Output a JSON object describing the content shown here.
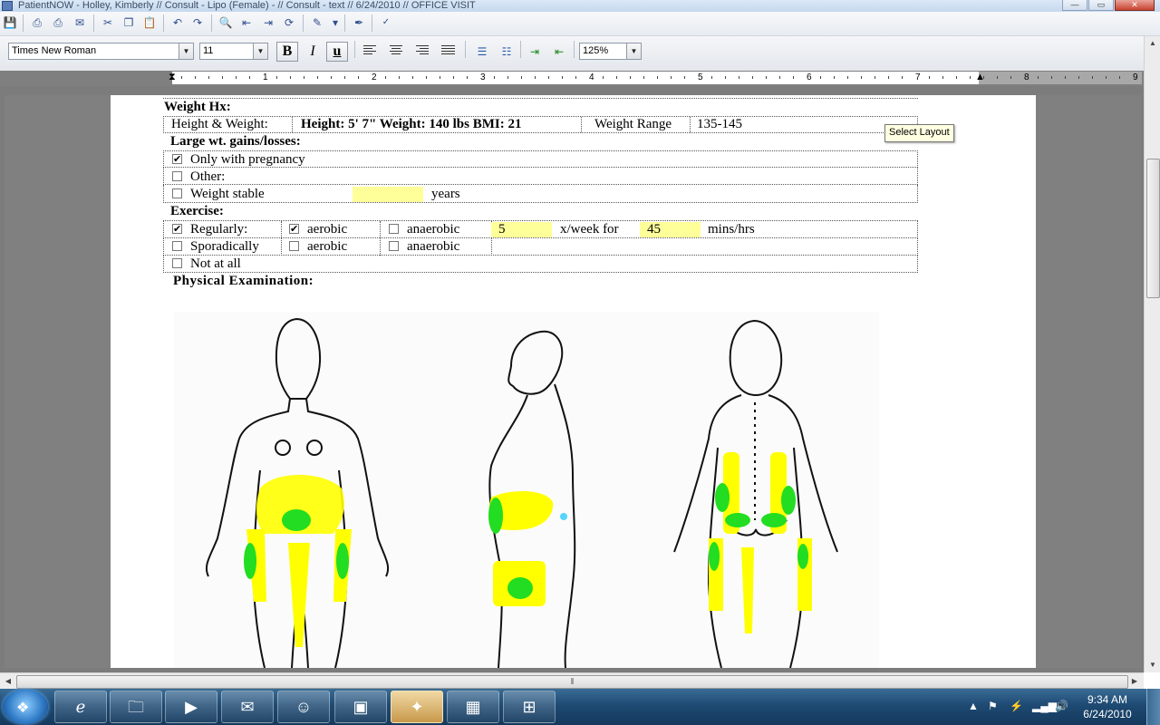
{
  "window": {
    "title": "PatientNOW - Holley, Kimberly // Consult - Lipo (Female) - // Consult - text // 6/24/2010 // OFFICE VISIT",
    "controls": {
      "minimize": "—",
      "maximize": "▭",
      "close": "✕"
    }
  },
  "toolbar": {
    "font_name": "Times New Roman",
    "font_size": "11",
    "bold": "B",
    "italic": "I",
    "underline": "u",
    "zoom": "125%"
  },
  "ruler": {
    "labels": [
      "1",
      "2",
      "3",
      "4",
      "5",
      "6",
      "7",
      "8",
      "9"
    ]
  },
  "tooltip": "Select Layout",
  "document": {
    "weight_hx_heading": "Weight Hx:",
    "height_weight_label": "Height & Weight:",
    "height_weight_value": "Height: 5' 7\" Weight: 140 lbs BMI: 21",
    "weight_range_label": "Weight Range",
    "weight_range_value": "135-145",
    "gains_heading": "Large wt. gains/losses:",
    "gains_options": [
      {
        "label": "Only with pregnancy",
        "checked": true
      },
      {
        "label": "Other:",
        "checked": false
      },
      {
        "label": "Weight stable",
        "checked": false
      }
    ],
    "weight_stable_years_value": "",
    "years_label": "years",
    "exercise_heading": "Exercise:",
    "exercise_rows": [
      {
        "label": "Regularly:",
        "checked": true,
        "aerobic": true,
        "anaerobic": false
      },
      {
        "label": "Sporadically",
        "checked": false,
        "aerobic": false,
        "anaerobic": false
      },
      {
        "label": "Not at all",
        "checked": false
      }
    ],
    "aerobic_label": "aerobic",
    "anaerobic_label": "anaerobic",
    "times_per_week": "5",
    "x_week_for_label": "x/week for",
    "minutes": "45",
    "mins_hrs_label": "mins/hrs",
    "physical_exam_heading": "Physical Examination:",
    "check_mark": "✔"
  },
  "taskbar": {
    "clock_time": "9:34 AM",
    "clock_date": "6/24/2010"
  },
  "colors": {
    "highlight_yellow": "#ffff99",
    "marking_yellow": "#ffff00",
    "marking_green": "#22dd22"
  }
}
